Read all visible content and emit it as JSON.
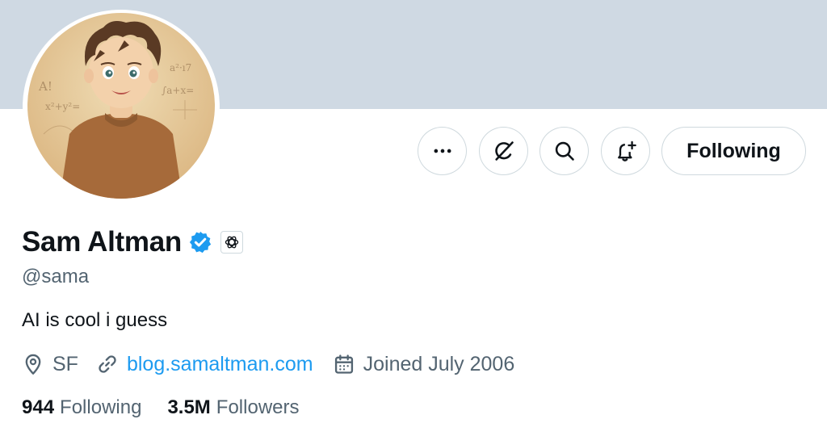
{
  "profile": {
    "display_name": "Sam Altman",
    "handle": "@sama",
    "bio": "AI is cool i guess",
    "location": "SF",
    "website": "blog.samaltman.com",
    "joined": "Joined July 2006",
    "following_count": "944",
    "following_label": "Following",
    "followers_count": "3.5M",
    "followers_label": "Followers",
    "verified": true
  },
  "actions": {
    "follow_button_label": "Following",
    "more_icon": "more-horizontal-icon",
    "grok_icon": "grok-icon",
    "search_icon": "search-icon",
    "notify_icon": "bell-plus-icon"
  },
  "colors": {
    "banner": "#cfd9e3",
    "accent": "#1d9bf0",
    "text_primary": "#0f1419",
    "text_secondary": "#536471",
    "border": "#cfd9de"
  }
}
